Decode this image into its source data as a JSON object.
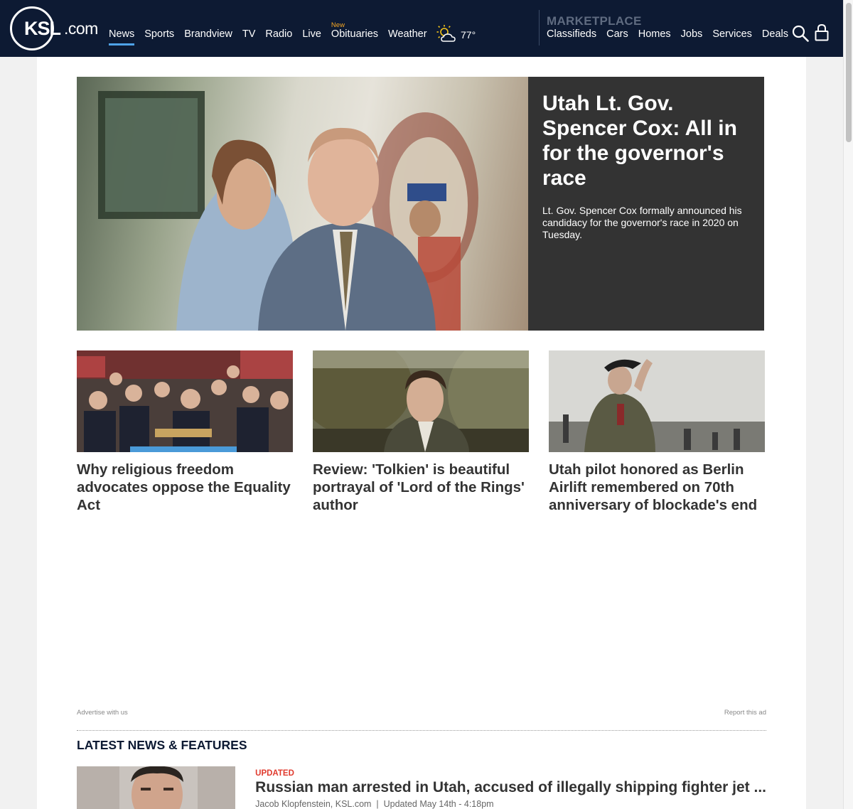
{
  "header": {
    "logo_ksl": "KSL",
    "logo_com": ".com",
    "nav": [
      "News",
      "Sports",
      "Brandview",
      "TV",
      "Radio",
      "Live",
      "Obituaries",
      "Weather"
    ],
    "nav_new_badge": "New",
    "weather_temp": "77°",
    "marketplace_title": "MARKETPLACE",
    "marketplace_nav": [
      "Classifieds",
      "Cars",
      "Homes",
      "Jobs",
      "Services",
      "Deals"
    ]
  },
  "hero": {
    "title": "Utah Lt. Gov. Spencer Cox: All in for the governor's race",
    "subtitle": "Lt. Gov. Spencer Cox formally announced his candidacy for the governor's race in 2020 on Tuesday."
  },
  "cards": [
    {
      "title": "Why religious freedom advocates oppose the Equality Act"
    },
    {
      "title": "Review: 'Tolkien' is beautiful portrayal of 'Lord of the Rings' author"
    },
    {
      "title": "Utah pilot honored as Berlin Airlift remembered on 70th anniversary of blockade's end"
    }
  ],
  "ad": {
    "advertise": "Advertise with us",
    "report": "Report this ad"
  },
  "latest": {
    "section_title": "LATEST NEWS & FEATURES",
    "items": [
      {
        "tag": "UPDATED",
        "title": "Russian man arrested in Utah, accused of illegally shipping fighter jet ...",
        "author": "Jacob Klopfenstein, KSL.com",
        "updated": "Updated May 14th - 4:18pm"
      }
    ]
  },
  "colors": {
    "nav_bg": "#0d1a33",
    "active_underline": "#4fa3e8",
    "new_badge": "#f5a623",
    "tag_red": "#e03a2e",
    "hero_panel": "#333333"
  }
}
